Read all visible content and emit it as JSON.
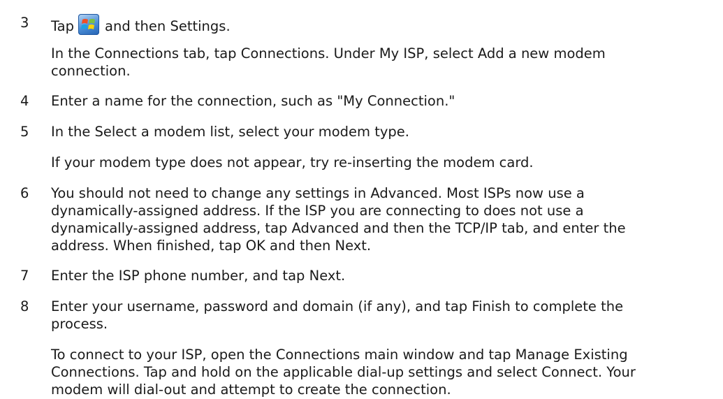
{
  "steps": [
    {
      "number": "3",
      "text_before_icon": "Tap",
      "icon": "windows-start-icon",
      "text_after_icon": "and then Settings.",
      "detail": [
        "In the Connections tab, tap Connections. Under My ISP, select Add a new modem",
        "connection."
      ]
    },
    {
      "number": "4",
      "text": [
        "Enter a name for the connection, such as \"My Connection.\""
      ]
    },
    {
      "number": "5",
      "text": [
        "In the Select a modem list, select your modem type."
      ],
      "detail": [
        "If your modem type does not appear, try re-inserting the modem card."
      ]
    },
    {
      "number": "6",
      "text": [
        "You should not need to change any settings in Advanced. Most ISPs now use a",
        "dynamically-assigned address. If the ISP you are connecting to does not use a",
        "dynamically-assigned address, tap Advanced and then the TCP/IP tab, and enter the",
        "address. When finished, tap OK and then Next."
      ]
    },
    {
      "number": "7",
      "text": [
        "Enter the ISP phone number, and tap Next."
      ]
    },
    {
      "number": "8",
      "text": [
        "Enter your username, password and domain (if any), and tap Finish to complete the",
        "process."
      ],
      "detail": [
        "To connect to your ISP, open the Connections main window and tap Manage Existing",
        "Connections. Tap and hold on the applicable dial-up settings and select Connect.  Your",
        "modem will dial-out and attempt to create the connection."
      ]
    }
  ]
}
